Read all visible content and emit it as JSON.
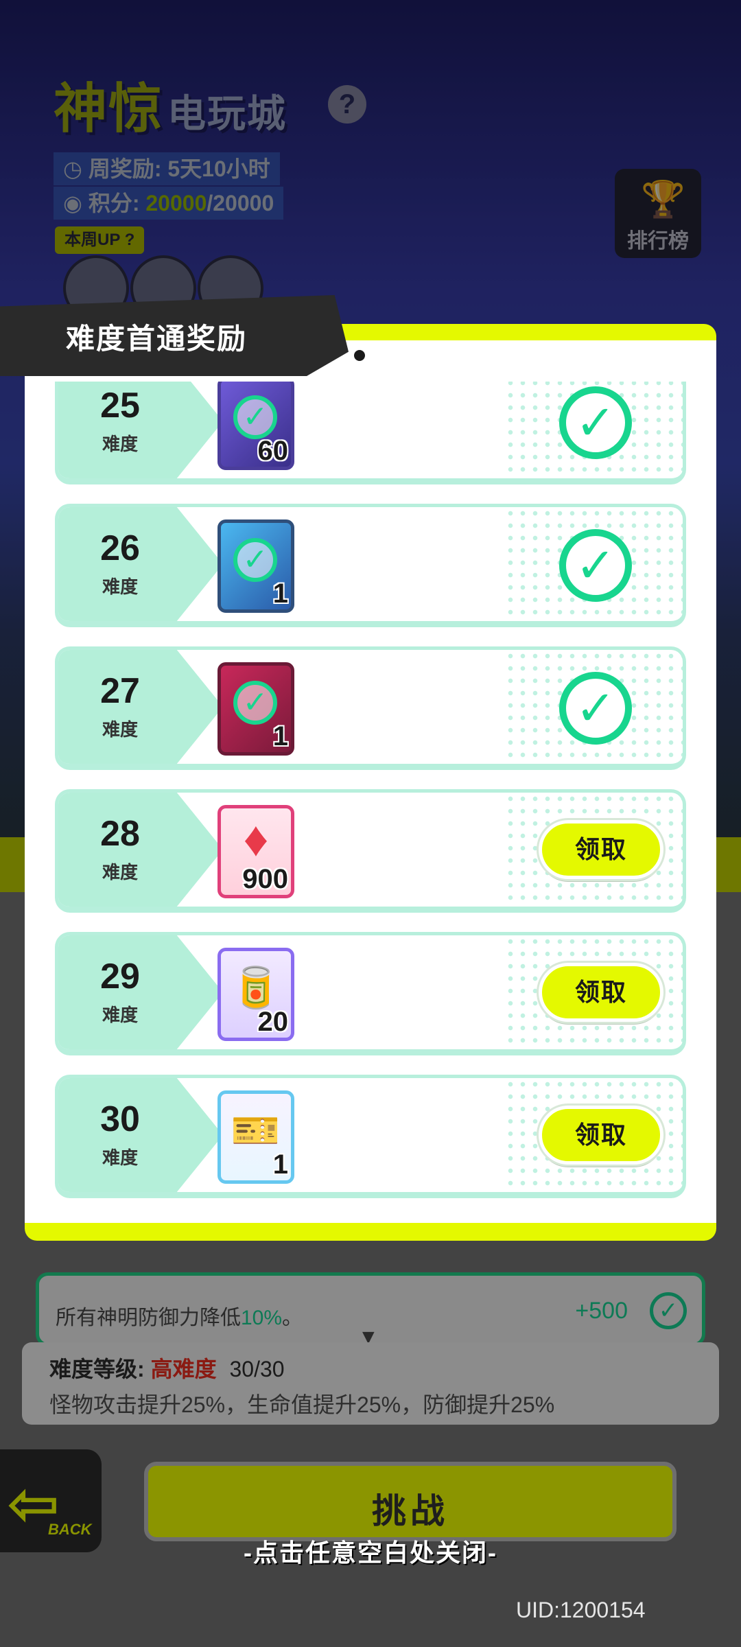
{
  "background": {
    "title_main": "神惊",
    "title_sub": "电玩城",
    "help_icon": "?",
    "weekly_reward_label": "周奖励: 5天10小时",
    "points_label": "积分:",
    "points_current": "20000",
    "points_total": "/20000",
    "weekly_up_label": "本周UP",
    "weekly_up_help": "?",
    "rank_label": "排行榜"
  },
  "modal": {
    "title": "难度首通奖励",
    "level_suffix": "难度",
    "rewards": [
      {
        "level": "25",
        "quantity": "60",
        "item": "card-pack",
        "status": "claimed"
      },
      {
        "level": "26",
        "quantity": "1",
        "item": "blue-token",
        "status": "claimed"
      },
      {
        "level": "27",
        "quantity": "1",
        "item": "red-card",
        "status": "claimed"
      },
      {
        "level": "28",
        "quantity": "900",
        "item": "red-crystal",
        "status": "claimable"
      },
      {
        "level": "29",
        "quantity": "20",
        "item": "cool-can",
        "status": "claimable"
      },
      {
        "level": "30",
        "quantity": "1",
        "item": "rainbow-ticket",
        "status": "claimable"
      }
    ],
    "claim_label": "领取"
  },
  "behind": {
    "buff_text_prefix": "所有神明防御力降低",
    "buff_pct": "10%",
    "buff_text_suffix": "。",
    "buff_score": "+500",
    "difficulty_label": "难度等级:",
    "difficulty_name": "高难度",
    "difficulty_progress": "30/30",
    "difficulty_desc": "怪物攻击提升25%，生命值提升25%，防御提升25%",
    "back_label": "BACK",
    "challenge_label": "挑战"
  },
  "close_hint": "-点击任意空白处关闭-",
  "uid": "UID:1200154",
  "colors": {
    "accent_yellow": "#e4f900",
    "mint": "#b4efd9",
    "check_green": "#18d58e",
    "danger_red": "#8a1a12"
  }
}
